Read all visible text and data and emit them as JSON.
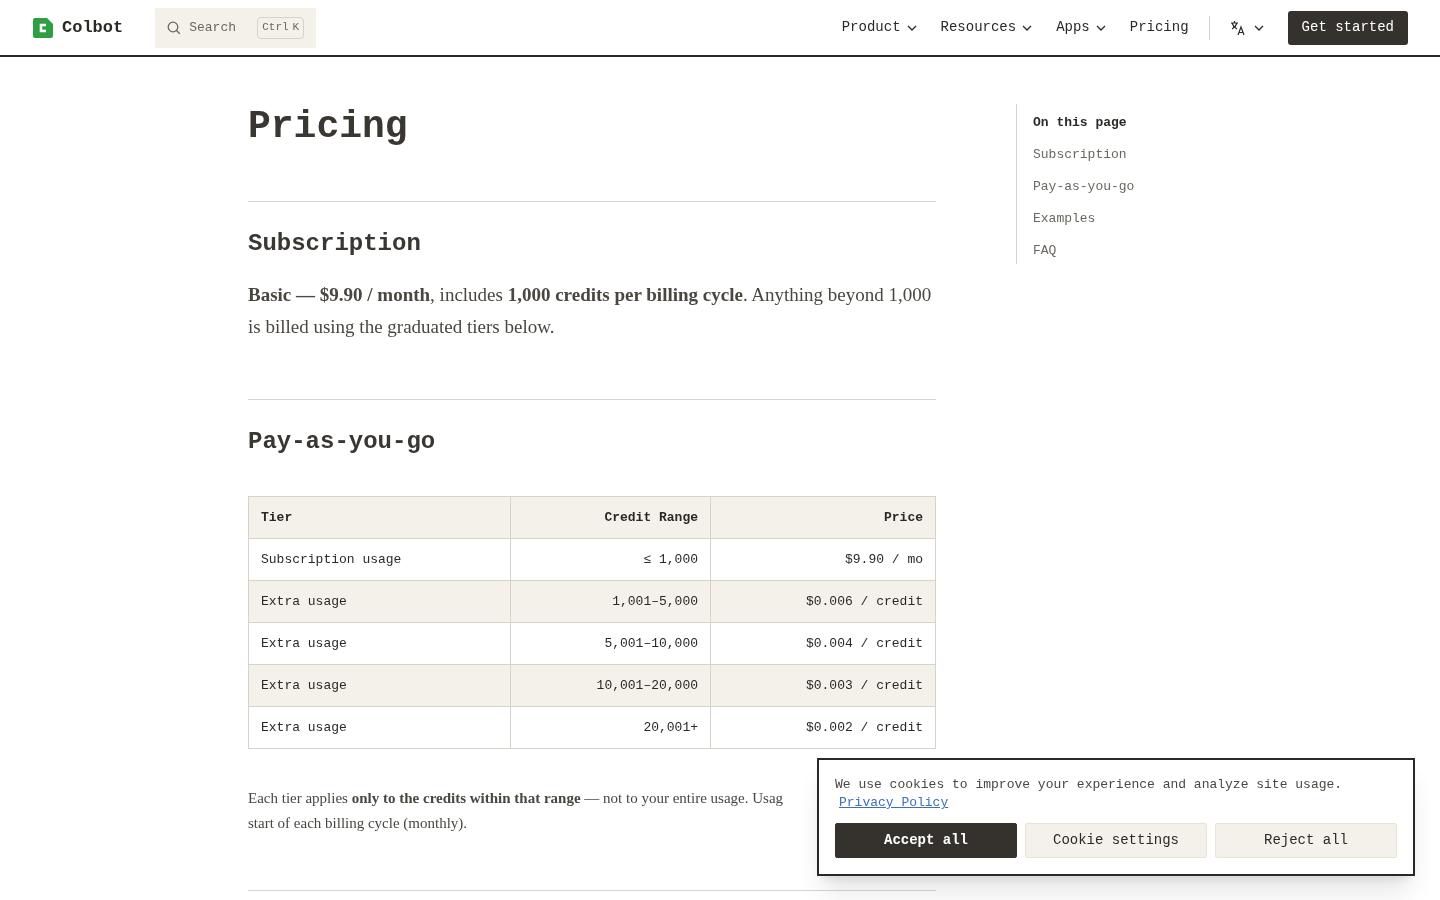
{
  "header": {
    "logo": "Colbot",
    "search": {
      "placeholder": "Search",
      "shortcut": [
        "Ctrl",
        "K"
      ]
    },
    "nav": [
      {
        "label": "Product",
        "dropdown": true
      },
      {
        "label": "Resources",
        "dropdown": true
      },
      {
        "label": "Apps",
        "dropdown": true
      },
      {
        "label": "Pricing",
        "dropdown": false
      }
    ],
    "cta": "Get started"
  },
  "page_title": "Pricing",
  "sections": [
    {
      "heading": "Subscription",
      "paragraph": "**Basic — $9.90 / month**, includes **1,000 credits per billing cycle**. Anything beyond 1,000 is billed using the graduated tiers below."
    },
    {
      "heading": "Pay-as-you-go"
    }
  ],
  "table": {
    "columns": [
      "Tier",
      "Credit Range",
      "Price"
    ],
    "rows": [
      [
        "Subscription usage",
        "≤ 1,000",
        "$9.90 / mo"
      ],
      [
        "Extra usage",
        "1,001–5,000",
        "$0.006 / credit"
      ],
      [
        "Extra usage",
        "5,001–10,000",
        "$0.004 / credit"
      ],
      [
        "Extra usage",
        "10,001–20,000",
        "$0.003 / credit"
      ],
      [
        "Extra usage",
        "20,001+",
        "$0.002 / credit"
      ]
    ]
  },
  "note_lines": [
    "Each tier applies **only to the credits within that range** — not to your entire usage. Usag",
    "start of each billing cycle (monthly)."
  ],
  "toc": {
    "title": "On this page",
    "items": [
      "Subscription",
      "Pay-as-you-go",
      "Examples",
      "FAQ"
    ]
  },
  "cookie_banner": {
    "text": "We use cookies to improve your experience and analyze site usage.",
    "link": "Privacy Policy",
    "buttons": [
      {
        "label": "Accept all",
        "kind": "primary"
      },
      {
        "label": "Cookie settings",
        "kind": "secondary"
      },
      {
        "label": "Reject all",
        "kind": "secondary"
      }
    ]
  }
}
